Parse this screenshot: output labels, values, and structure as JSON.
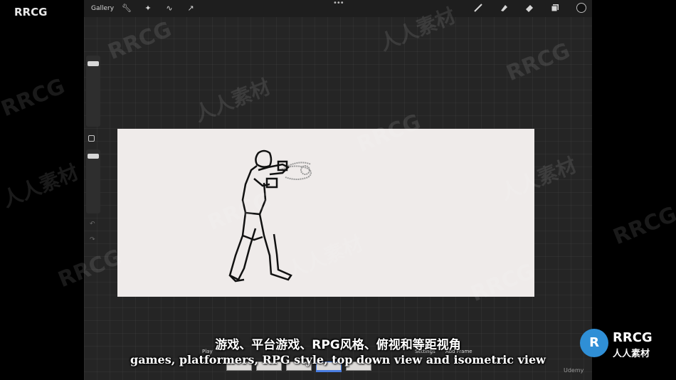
{
  "toolbar": {
    "gallery_label": "Gallery",
    "icons": [
      "wrench-icon",
      "magic-wand-icon",
      "selection-icon",
      "transform-arrow-icon",
      "brush-icon",
      "smudge-icon",
      "eraser-icon",
      "layers-icon"
    ]
  },
  "animation": {
    "play_label": "Play",
    "settings_label": "Settings",
    "add_frame_label": "Add Frame",
    "frame_count": 5
  },
  "watermark": {
    "corner_text": "RRCG",
    "latin": "RRCG",
    "chinese": "人人素材"
  },
  "subtitles": {
    "chinese": "游戏、平台游戏、RPG风格、俯视和等距视角",
    "english": "games, platformers, RPG style, top down view and isometric view"
  },
  "logo": {
    "line1": "RRCG",
    "line2": "人人素材"
  },
  "footer": {
    "udemy": "Udemy"
  },
  "colors": {
    "canvas": "#efebea",
    "app_bg": "#252525",
    "accent": "#4a7de0",
    "logo_blue": "#2f8fd6"
  }
}
